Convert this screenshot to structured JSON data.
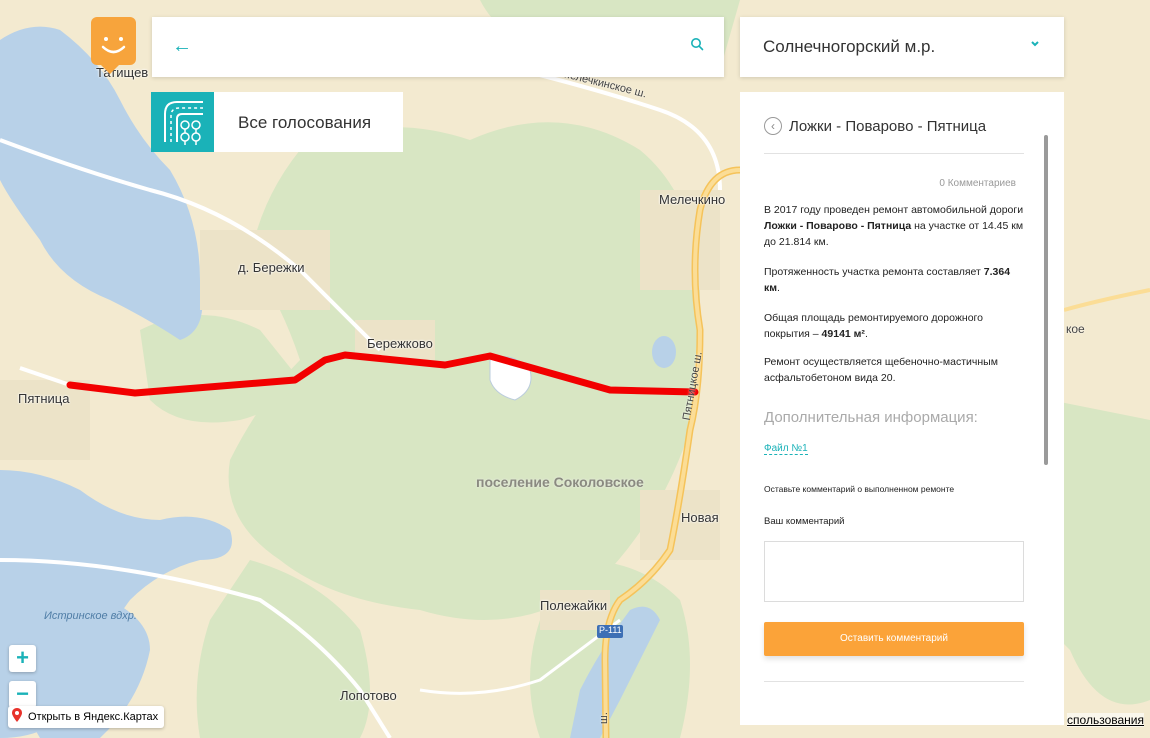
{
  "header": {
    "search_value": "",
    "region": "Солнечногорский м.р."
  },
  "nav": {
    "all_votes_label": "Все голосования"
  },
  "map": {
    "labels": {
      "tatishchevo": "Татищев",
      "melechkino": "Мелечкино",
      "d_berezhki": "д. Бережки",
      "berezhkovo": "Бережково",
      "pyatnitsa": "Пятница",
      "region": "поселение Соколовское",
      "novaya": "Новая",
      "polezhayki": "Полежайки",
      "lopotovo": "Лопотово",
      "reservoir": "Истринское вдхр.",
      "melechkinskoe_road": "Мелечкинское ш.",
      "pyatnitskoe_road": "Пятницкое ш.",
      "r111": "Р-111",
      "edge_suffix": "кое",
      "road_bottom": "ш."
    },
    "route_color": "#f20000",
    "zoom_in": "+",
    "zoom_out": "−",
    "open_in_ymaps": "Открыть в Яндекс.Картах",
    "terms": "спользования"
  },
  "panel": {
    "title": "Ложки - Поварово - Пятница",
    "comments_count": "0 Комментариев",
    "p1_a": "В 2017 году проведен ремонт автомобильной дороги ",
    "p1_b": "Ложки - Поварово - Пятница",
    "p1_c": " на участке от 14.45 км до 21.814 км.",
    "p2_a": "Протяженность участка ремонта составляет ",
    "p2_b": "7.364 км",
    "p2_c": ".",
    "p3_a": "Общая площадь ремонтируемого дорожного покрытия – ",
    "p3_b": "49141 м²",
    "p3_c": ".",
    "p4": "Ремонт осуществляется щебеночно-мастичным асфальтобетоном вида 20.",
    "additional": "Дополнительная информация:",
    "file_link": "Файл №1",
    "hint": "Оставьте комментарий о выполненном ремонте",
    "your_comment": "Ваш комментарий",
    "comment_value": "",
    "submit": "Оставить комментарий"
  },
  "colors": {
    "accent": "#1ab2b8",
    "button": "#fba339",
    "logo": "#f7a43c"
  }
}
